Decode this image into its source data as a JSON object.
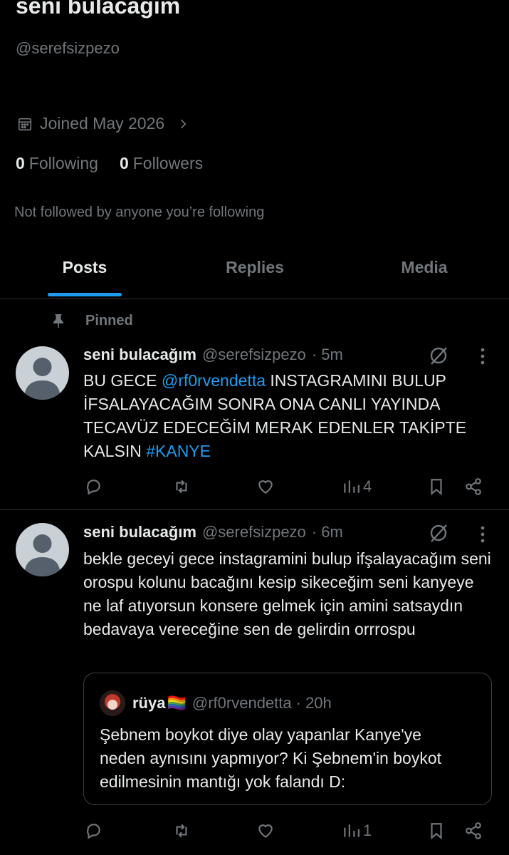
{
  "profile": {
    "name": "seni bulacağım",
    "handle": "@serefsizpezo",
    "joined": "Joined May 2026",
    "following_count": "0",
    "following_label": "Following",
    "followers_count": "0",
    "followers_label": "Followers",
    "not_followed": "Not followed by anyone you’re following"
  },
  "tabs": [
    {
      "label": "Posts",
      "active": true
    },
    {
      "label": "Replies",
      "active": false
    },
    {
      "label": "Media",
      "active": false
    }
  ],
  "pinned_label": "Pinned",
  "posts": [
    {
      "name": "seni bulacağım",
      "handle": "@serefsizpezo",
      "time": "· 5m",
      "text_before": "BU GECE ",
      "mention": "@rf0rvendetta",
      "text_middle": " INSTAGRAMINI BULUP İFSALAYACAĞIM SONRA ONA CANLI YAYINDA TECAVÜZ EDECEĞİM MERAK EDENLER TAKİPTE KALSIN ",
      "hashtag": "#KANYE",
      "views": "4"
    },
    {
      "name": "seni bulacağım",
      "handle": "@serefsizpezo",
      "time": "· 6m",
      "text": "bekle geceyi gece instagramini bulup ifşalayacağım seni orospu kolunu bacağını kesip sikeceğim seni kanyeye ne laf atıyorsun konsere gelmek için amini satsaydın bedavaya vereceğine sen de gelirdin orrrospu",
      "views": "1",
      "quote": {
        "name": "rüya",
        "flag": "🏳️‍🌈",
        "handle": "@rf0rvendetta",
        "time": "· 20h",
        "text": "Şebnem boykot diye olay yapanlar Kanye'ye neden aynısını yapmıyor? Ki Şebnem'in boykot edilmesinin mantığı yok falandı D:"
      }
    }
  ],
  "colors": {
    "background": "#000000",
    "text": "#e7e9ea",
    "muted": "#71767b",
    "accent": "#1d9bf0",
    "divider": "#2f3336"
  }
}
